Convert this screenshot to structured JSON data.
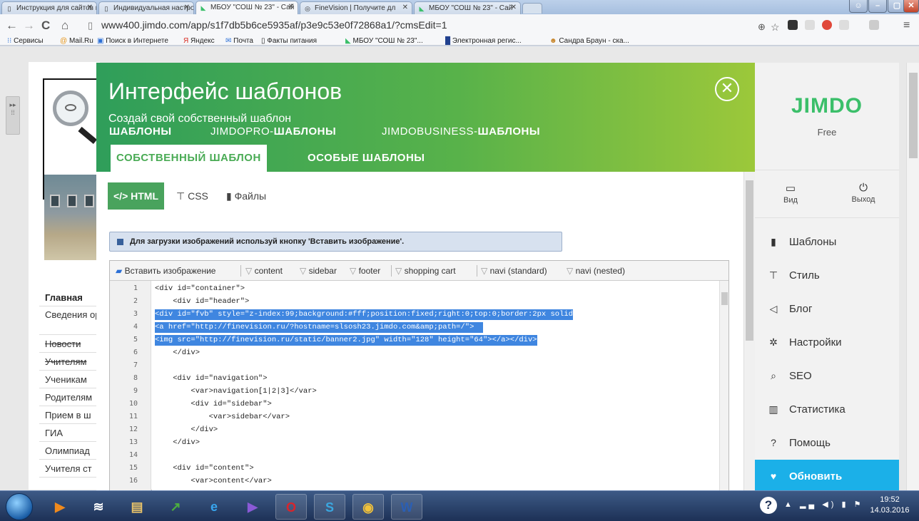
{
  "browser": {
    "tabs": [
      {
        "icon": "page-icon",
        "title": "Инструкция для сайтов н",
        "active": false
      },
      {
        "icon": "page-icon",
        "title": "Индивидуальная настрой",
        "active": false
      },
      {
        "icon": "jimdo-icon",
        "title": "МБОУ \"СОШ № 23\" - Сай",
        "active": true
      },
      {
        "icon": "finevision-icon",
        "title": "FineVision | Получите дл",
        "active": false
      },
      {
        "icon": "jimdo-icon",
        "title": "МБОУ \"СОШ № 23\" - Сай",
        "active": false
      }
    ],
    "url": "www400.jimdo.com/app/s1f7db5b6ce5935af/p3e9c53e0f72868a1/?cmsEdit=1",
    "bookmarks": [
      {
        "icon": "apps-icon",
        "label": "Сервисы"
      },
      {
        "icon": "mailru-icon",
        "label": "Mail.Ru"
      },
      {
        "icon": "search-icon",
        "label": "Поиск в Интернете"
      },
      {
        "icon": "yandex-icon",
        "label": "Яндекс"
      },
      {
        "icon": "mail-icon",
        "label": "Почта"
      },
      {
        "icon": "page-icon",
        "label": "Факты питания"
      },
      {
        "icon": "jimdo-icon",
        "label": "МБОУ \"СОШ № 23\"..."
      },
      {
        "icon": "registry-icon",
        "label": "Электронная регис..."
      },
      {
        "icon": "face-icon",
        "label": "Сандра Браун - ска..."
      }
    ]
  },
  "site": {
    "nav": [
      {
        "label": "Главная",
        "style": "bold"
      },
      {
        "label": "Сведения организац",
        "style": "two"
      },
      {
        "label": "Новости",
        "style": "strike"
      },
      {
        "label": "Учителям",
        "style": "strike"
      },
      {
        "label": "Ученикам",
        "style": ""
      },
      {
        "label": "Родителям",
        "style": ""
      },
      {
        "label": "Прием в ш",
        "style": ""
      },
      {
        "label": "ГИА",
        "style": ""
      },
      {
        "label": "Олимпиад",
        "style": ""
      },
      {
        "label": "Учителя ст",
        "style": ""
      }
    ]
  },
  "panel": {
    "title": "Интерфейс шаблонов",
    "subtitle": "Создай свой собственный шаблон",
    "template_tabs": [
      {
        "prefix": "",
        "bold": "ШАБЛОНЫ"
      },
      {
        "prefix": "JIMDOPRO-",
        "bold": "ШАБЛОНЫ"
      },
      {
        "prefix": "JIMDOBUSINESS-",
        "bold": "ШАБЛОНЫ"
      }
    ],
    "sub_tabs": [
      "СОБСТВЕННЫЙ ШАБЛОН",
      "ОСОБЫЕ ШАБЛОНЫ"
    ],
    "code_tabs": [
      "HTML",
      "CSS",
      "Файлы"
    ],
    "notice": "Для загрузки изображений используй кнопку 'Вставить изображение'.",
    "editor_toolbar": [
      "Вставить изображение",
      "content",
      "sidebar",
      "footer",
      "shopping cart",
      "navi (standard)",
      "navi (nested)"
    ],
    "code_lines": [
      {
        "n": "1",
        "text": "<div id=\"container\">",
        "selected": false
      },
      {
        "n": "2",
        "text": "    <div id=\"header\">",
        "selected": false
      },
      {
        "n": "3",
        "text": "<div id=\"fvb\" style=\"z-index:99;background:#fff;position:fixed;right:0;top:0;border:2px solid",
        "selected": true
      },
      {
        "n": "4",
        "text": "<a href=\"http://finevision.ru/?hostname=slsosh23.jimdo.com&amp;path=/\">  ",
        "selected": true
      },
      {
        "n": "5",
        "text": "<img src=\"http://finevision.ru/static/banner2.jpg\" width=\"128\" height=\"64\"></a></div>",
        "selected": true
      },
      {
        "n": "6",
        "text": "    </div>",
        "selected": false
      },
      {
        "n": "7",
        "text": "",
        "selected": false
      },
      {
        "n": "8",
        "text": "    <div id=\"navigation\">",
        "selected": false
      },
      {
        "n": "9",
        "text": "        <var>navigation[1|2|3]</var>",
        "selected": false
      },
      {
        "n": "10",
        "text": "        <div id=\"sidebar\">",
        "selected": false
      },
      {
        "n": "11",
        "text": "            <var>sidebar</var>",
        "selected": false
      },
      {
        "n": "12",
        "text": "        </div>",
        "selected": false
      },
      {
        "n": "13",
        "text": "    </div>",
        "selected": false
      },
      {
        "n": "14",
        "text": "",
        "selected": false
      },
      {
        "n": "15",
        "text": "    <div id=\"content\">",
        "selected": false
      },
      {
        "n": "16",
        "text": "        <var>content</var>",
        "selected": false
      }
    ]
  },
  "jimdo": {
    "logo": "JIMDO",
    "plan": "Free",
    "view_label": "Вид",
    "logout_label": "Выход",
    "menu": [
      {
        "icon": "templates-icon",
        "glyph": "▮",
        "label": "Шаблоны"
      },
      {
        "icon": "style-icon",
        "glyph": "⊤",
        "label": "Стиль"
      },
      {
        "icon": "blog-icon",
        "glyph": "◁",
        "label": "Блог"
      },
      {
        "icon": "settings-icon",
        "glyph": "✲",
        "label": "Настройки"
      },
      {
        "icon": "seo-icon",
        "glyph": "⌕",
        "label": "SEO"
      },
      {
        "icon": "stats-icon",
        "glyph": "▥",
        "label": "Статистика"
      },
      {
        "icon": "help-icon",
        "glyph": "?",
        "label": "Помощь"
      },
      {
        "icon": "heart-icon",
        "glyph": "♥",
        "label": "Обновить"
      }
    ]
  },
  "taskbar": {
    "apps": [
      {
        "icon": "media-player-icon",
        "color": "#f08a1d",
        "glyph": "▶"
      },
      {
        "icon": "wifi-icon",
        "color": "#ffffff",
        "glyph": "≋"
      },
      {
        "icon": "explorer-icon",
        "color": "#e8c36a",
        "glyph": "▤"
      },
      {
        "icon": "chart-app-icon",
        "color": "#4cae3f",
        "glyph": "↗"
      },
      {
        "icon": "ie-icon",
        "color": "#38a6ef",
        "glyph": "e"
      },
      {
        "icon": "media-icon",
        "color": "#8a5ad6",
        "glyph": "▶"
      },
      {
        "icon": "opera-icon",
        "color": "#d9242b",
        "glyph": "O"
      },
      {
        "icon": "skype-icon",
        "color": "#3aa7e0",
        "glyph": "S"
      },
      {
        "icon": "chrome-icon",
        "color": "#f2c23a",
        "glyph": "◉"
      },
      {
        "icon": "word-icon",
        "color": "#2b5fb4",
        "glyph": "W"
      }
    ],
    "time": "19:52",
    "date": "14.03.2016"
  },
  "colors": {
    "jimdo_green": "#3bbf6a",
    "cta_blue": "#1bb0e8",
    "selection": "#3f86e0"
  }
}
